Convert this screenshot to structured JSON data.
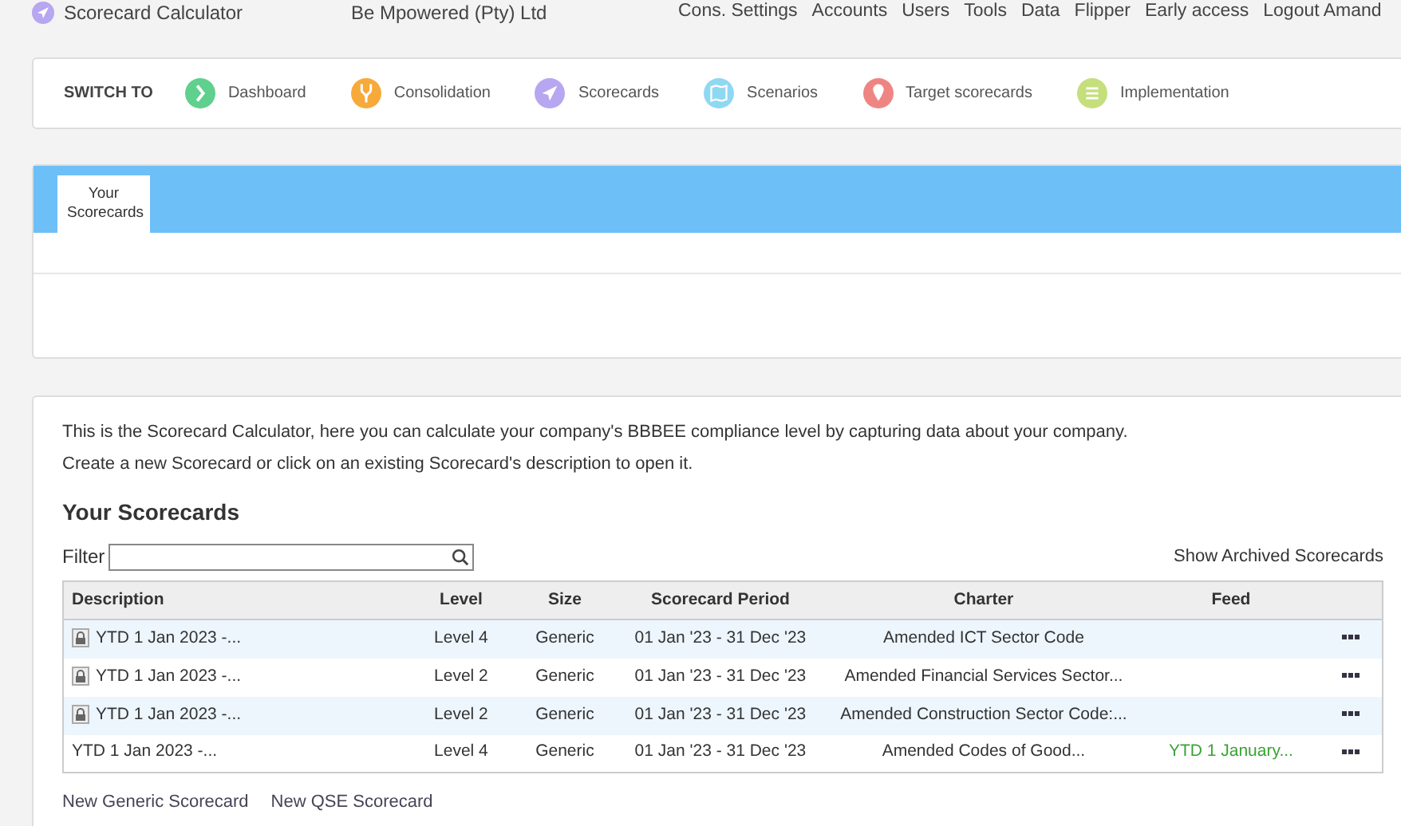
{
  "app": {
    "title": "Scorecard Calculator",
    "company": "Be Mpowered (Pty) Ltd"
  },
  "top_menu": [
    "Cons. Settings",
    "Accounts",
    "Users",
    "Tools",
    "Data",
    "Flipper",
    "Early access",
    "Logout Amand"
  ],
  "switch_bar": {
    "label": "SWITCH TO",
    "items": [
      {
        "label": "Dashboard",
        "kind": "chevron",
        "color": "#5fd08e"
      },
      {
        "label": "Consolidation",
        "kind": "fork",
        "color": "#f7a93a"
      },
      {
        "label": "Scorecards",
        "kind": "plane",
        "color": "#b7a6f0"
      },
      {
        "label": "Scenarios",
        "kind": "map",
        "color": "#8fd8f3"
      },
      {
        "label": "Target scorecards",
        "kind": "pin",
        "color": "#ee8583"
      },
      {
        "label": "Implementation",
        "kind": "list",
        "color": "#c5df7c"
      }
    ]
  },
  "tabs": [
    {
      "label": "Your Scorecards",
      "selected": true
    }
  ],
  "intro": [
    "This is the Scorecard Calculator, here you can calculate your company's BBBEE compliance level by capturing data about your company.",
    "Create a new Scorecard or click on an existing Scorecard's description to open it."
  ],
  "section_title": "Your Scorecards",
  "filter": {
    "label": "Filter"
  },
  "archived_link": "Show Archived Scorecards",
  "table": {
    "columns": [
      "Description",
      "Level",
      "Size",
      "Scorecard Period",
      "Charter",
      "Feed"
    ],
    "rows": [
      {
        "locked": true,
        "cells": [
          "YTD 1 Jan 2023 -...",
          "Level 4",
          "Generic",
          "01 Jan '23 - 31 Dec '23",
          "Amended ICT Sector Code",
          ""
        ]
      },
      {
        "locked": true,
        "cells": [
          "YTD 1 Jan 2023 -...",
          "Level 2",
          "Generic",
          "01 Jan '23 - 31 Dec '23",
          "Amended Financial Services Sector...",
          ""
        ]
      },
      {
        "locked": true,
        "cells": [
          "YTD 1 Jan 2023 -...",
          "Level 2",
          "Generic",
          "01 Jan '23 - 31 Dec '23",
          "Amended Construction Sector Code:...",
          ""
        ]
      },
      {
        "locked": false,
        "cells": [
          "YTD 1 Jan 2023 -...",
          "Level 4",
          "Generic",
          "01 Jan '23 - 31 Dec '23",
          "Amended Codes of Good...",
          "YTD 1 January..."
        ]
      }
    ]
  },
  "actions": [
    "New Generic Scorecard",
    "New QSE Scorecard"
  ]
}
